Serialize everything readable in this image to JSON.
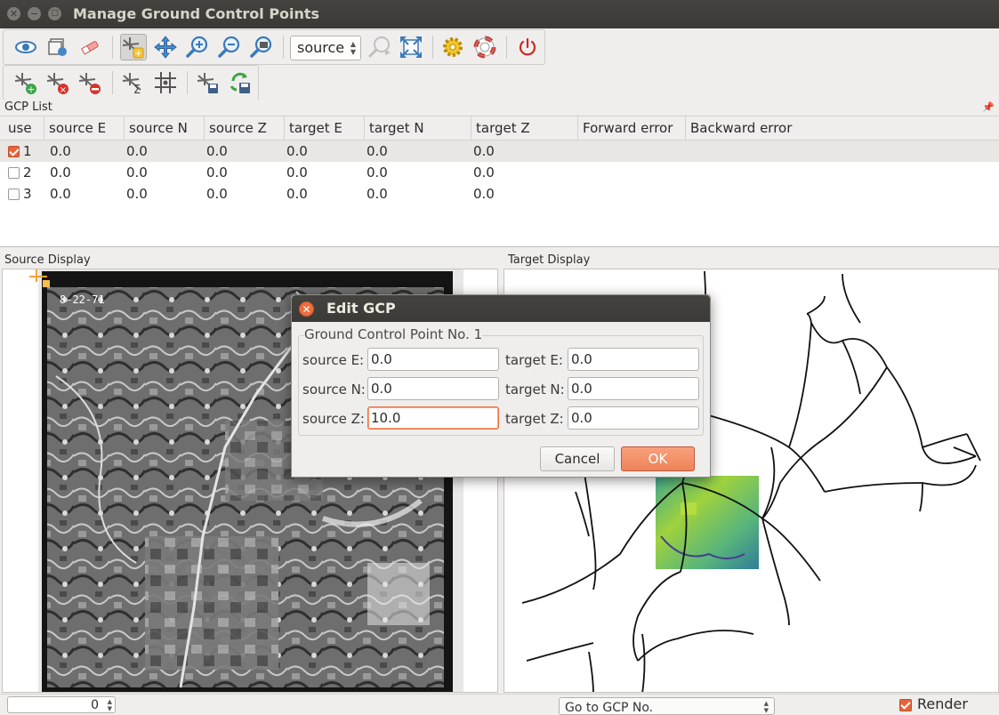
{
  "window": {
    "title": "Manage Ground Control Points",
    "close_glyph": "✕",
    "minimize_glyph": "−",
    "maximize_glyph": "▢"
  },
  "toolbar1": {
    "buttons": [
      "open-raster-icon",
      "start-georeferencing-icon",
      "generate-gdal-script-icon",
      "link-georeferencer-icon",
      "pan-icon",
      "zoom-in-icon",
      "zoom-out-icon",
      "zoom-to-layer-icon"
    ],
    "combo_value": "source",
    "extra_buttons": [
      "zoom-last-icon",
      "zoom-next-icon",
      "settings-icon",
      "help-icon",
      "quit-icon"
    ]
  },
  "toolbar2": {
    "buttons": [
      "add-point-icon",
      "delete-point-icon",
      "move-gcp-icon",
      "full-histogram-stretch-icon",
      "local-histogram-stretch-icon",
      "save-gcp-points-icon",
      "load-gcp-points-icon"
    ]
  },
  "gcp_list": {
    "title": "GCP List",
    "columns": [
      "use",
      "source E",
      "source N",
      "source Z",
      "target E",
      "target N",
      "target Z",
      "Forward error",
      "Backward error"
    ],
    "rows": [
      {
        "use": true,
        "id": "1",
        "source_e": "0.0",
        "source_n": "0.0",
        "source_z": "0.0",
        "target_e": "0.0",
        "target_n": "0.0",
        "target_z": "0.0"
      },
      {
        "use": false,
        "id": "2",
        "source_e": "0.0",
        "source_n": "0.0",
        "source_z": "0.0",
        "target_e": "0.0",
        "target_n": "0.0",
        "target_z": "0.0"
      },
      {
        "use": false,
        "id": "3",
        "source_e": "0.0",
        "source_n": "0.0",
        "source_z": "0.0",
        "target_e": "0.0",
        "target_n": "0.0",
        "target_z": "0.0"
      }
    ]
  },
  "source_display": {
    "title": "Source Display",
    "photo_label": "8-22-71"
  },
  "target_display": {
    "title": "Target Display"
  },
  "edit_gcp_dialog": {
    "title": "Edit GCP",
    "close_glyph": "✕",
    "group_label": "Ground Control Point No. 1",
    "source_e_label": "source E:",
    "source_e_value": "0.0",
    "source_n_label": "source N:",
    "source_n_value": "0.0",
    "source_z_label": "source Z:",
    "source_z_value": "10.0",
    "target_e_label": "target E:",
    "target_e_value": "0.0",
    "target_n_label": "target N:",
    "target_n_value": "0.0",
    "target_z_label": "target Z:",
    "target_z_value": "0.0",
    "cancel_label": "Cancel",
    "ok_label": "OK"
  },
  "statusbar": {
    "spin_value": "0",
    "goto_placeholder": "Go to GCP No.",
    "render_label": "Render",
    "render_checked": true
  },
  "colors": {
    "accent": "#e7643a",
    "titlebar": "#3c3b37",
    "selection_row": "#e9e7e4"
  }
}
